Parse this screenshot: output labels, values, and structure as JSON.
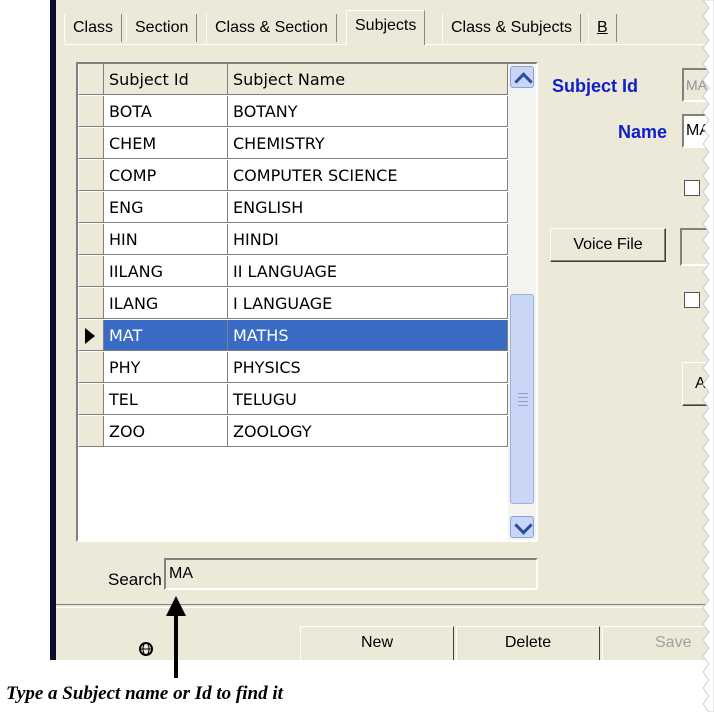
{
  "tabs": [
    {
      "label": "Class"
    },
    {
      "label": "Section"
    },
    {
      "label": "Class & Section"
    },
    {
      "label": "Subjects"
    },
    {
      "label": "Class & Subjects"
    },
    {
      "label": "B"
    }
  ],
  "grid": {
    "columns": [
      "Subject Id",
      "Subject Name"
    ],
    "rows": [
      {
        "id": "BOTA",
        "name": "BOTANY"
      },
      {
        "id": "CHEM",
        "name": "CHEMISTRY"
      },
      {
        "id": "COMP",
        "name": "COMPUTER SCIENCE"
      },
      {
        "id": "ENG",
        "name": "ENGLISH"
      },
      {
        "id": "HIN",
        "name": "HINDI"
      },
      {
        "id": "IILANG",
        "name": "II LANGUAGE"
      },
      {
        "id": "ILANG",
        "name": "I LANGUAGE"
      },
      {
        "id": "MAT",
        "name": "MATHS",
        "selected": true
      },
      {
        "id": "PHY",
        "name": "PHYSICS"
      },
      {
        "id": "TEL",
        "name": "TELUGU"
      },
      {
        "id": "ZOO",
        "name": "ZOOLOGY"
      }
    ]
  },
  "form": {
    "subject_id_label": "Subject Id",
    "subject_id_value": "MA",
    "name_label": "Name",
    "name_value": "MA",
    "voice_file_label": "Voice File",
    "a_button_label": "A"
  },
  "search": {
    "label": "Search",
    "value": "MA"
  },
  "toolbar": {
    "new_label": "New",
    "delete_label": "Delete",
    "save_label": "Save"
  },
  "annotation": "Type a Subject name or Id to find it",
  "colors": {
    "selection": "#3a6bc4",
    "label_blue": "#1020c8",
    "panel": "#ece9d8"
  }
}
